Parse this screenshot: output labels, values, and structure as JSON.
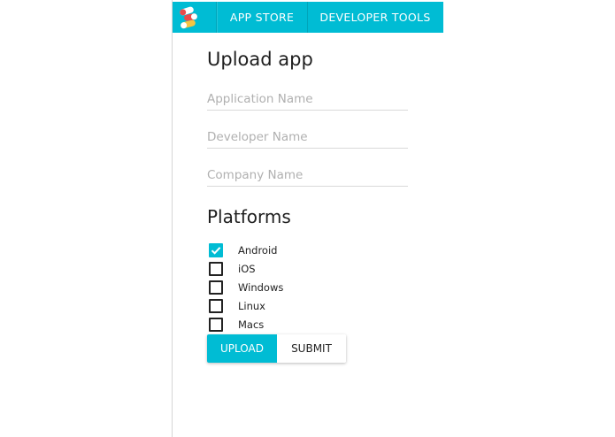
{
  "nav": {
    "tabs": [
      {
        "label": "APP STORE"
      },
      {
        "label": "DEVELOPER TOOLS"
      }
    ]
  },
  "form": {
    "title": "Upload app",
    "fields": [
      {
        "placeholder": "Application Name",
        "value": ""
      },
      {
        "placeholder": "Developer Name",
        "value": ""
      },
      {
        "placeholder": "Company Name",
        "value": ""
      }
    ],
    "platforms_title": "Platforms",
    "platforms": [
      {
        "label": "Android",
        "checked": true
      },
      {
        "label": "iOS",
        "checked": false
      },
      {
        "label": "Windows",
        "checked": false
      },
      {
        "label": "Linux",
        "checked": false
      },
      {
        "label": "Macs",
        "checked": false
      }
    ],
    "buttons": {
      "upload": "UPLOAD",
      "submit": "SUBMIT"
    }
  },
  "colors": {
    "accent": "#00bcd4",
    "logo_red": "#e84b4b",
    "logo_yellow": "#f5c542",
    "logo_white": "#ffffff"
  },
  "icons": {
    "logo": "app-logo-icon",
    "check": "check-icon"
  }
}
